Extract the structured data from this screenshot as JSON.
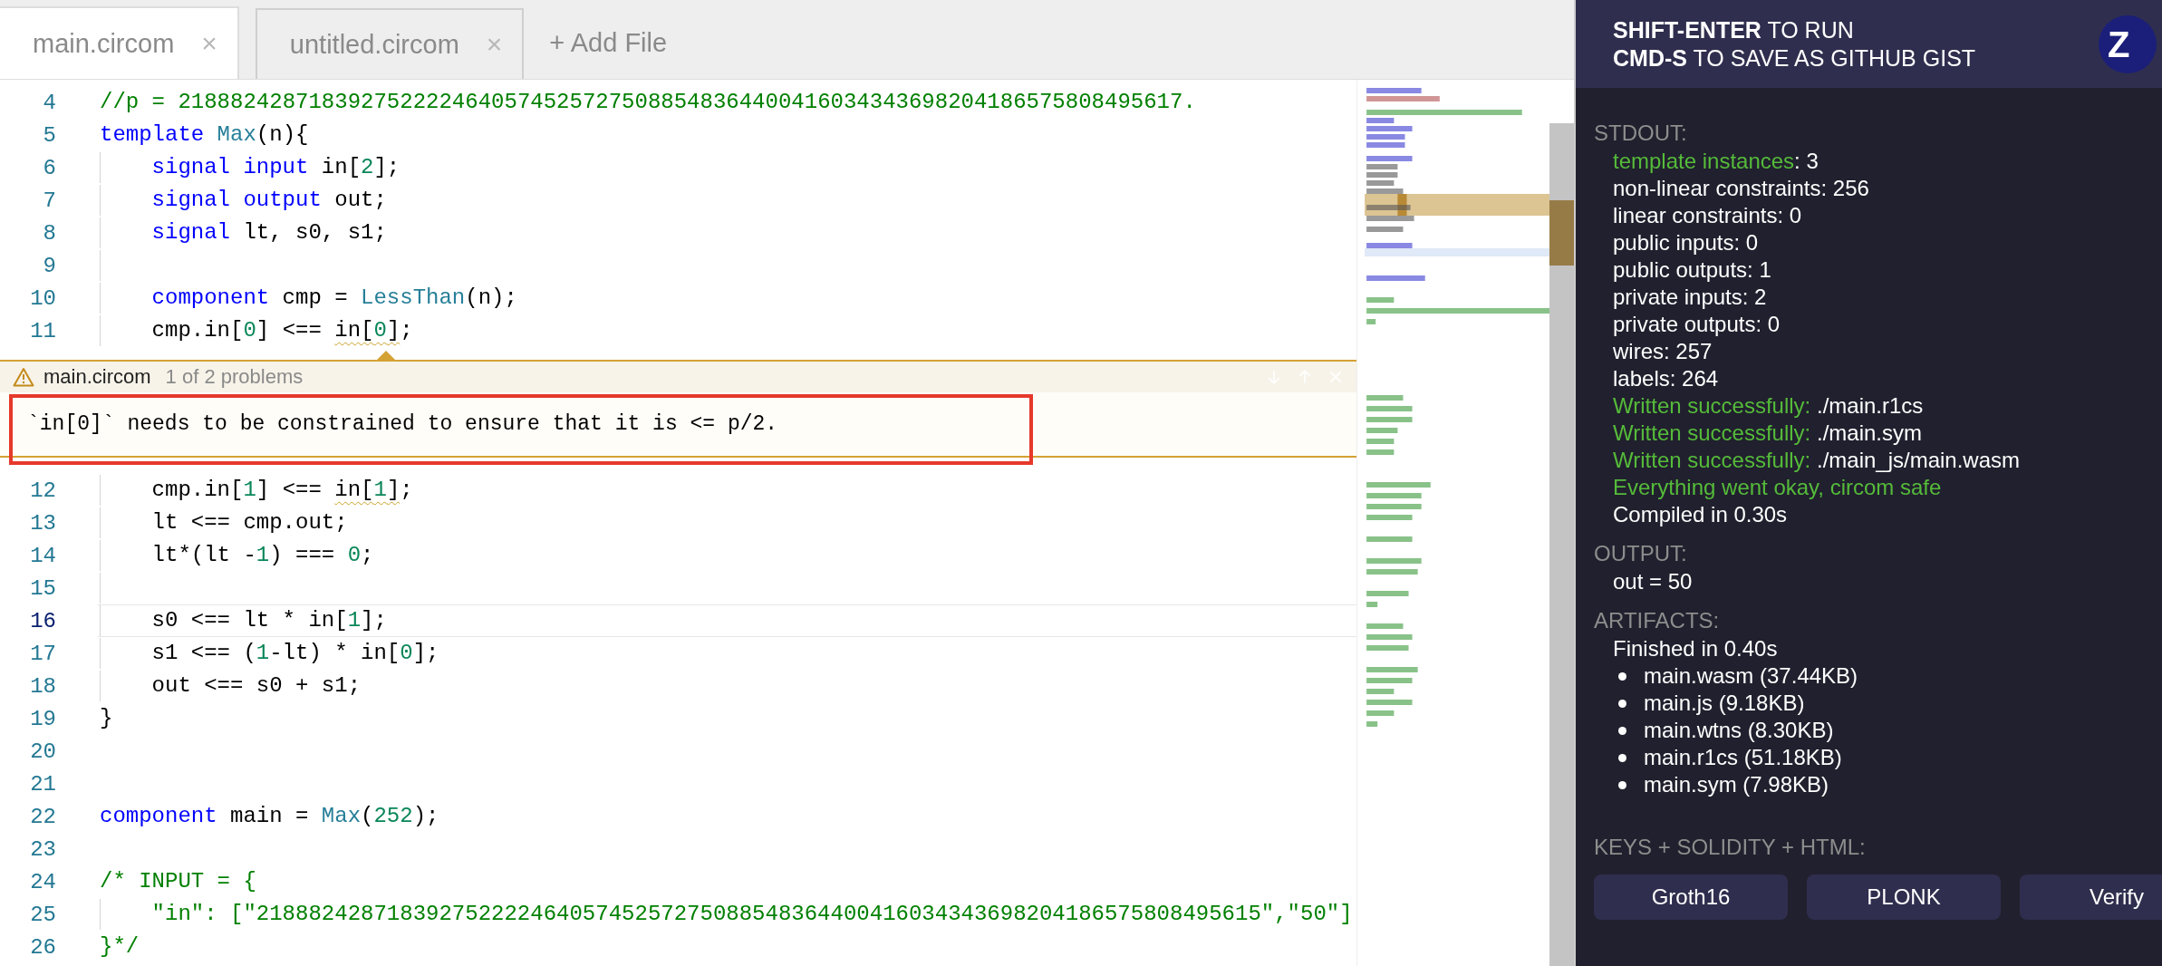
{
  "tabs": [
    {
      "label": "main.circom",
      "close": "×",
      "selected": true
    },
    {
      "label": "untitled.circom",
      "close": "×",
      "selected": false
    }
  ],
  "add_file": "+ Add File",
  "editor": {
    "lines": [
      {
        "kind": "code",
        "number": "4",
        "current": false,
        "indented": false,
        "tokens": [
          {
            "text": "//p = 21888242871839275222246405745257275088548364400416034343698204186575808495617.",
            "kind": "comment",
            "squiggly": false
          }
        ]
      },
      {
        "kind": "code",
        "number": "5",
        "current": false,
        "indented": false,
        "tokens": [
          {
            "text": "template",
            "kind": "keyword",
            "squiggly": false
          },
          {
            "text": " Max",
            "kind": "type",
            "squiggly": false
          },
          {
            "text": "(n){",
            "kind": "plain",
            "squiggly": false
          }
        ]
      },
      {
        "kind": "code",
        "number": "6",
        "current": false,
        "indented": true,
        "tokens": [
          {
            "text": "signal input",
            "kind": "keyword",
            "squiggly": false
          },
          {
            "text": " in[",
            "kind": "plain",
            "squiggly": false
          },
          {
            "text": "2",
            "kind": "number",
            "squiggly": false
          },
          {
            "text": "];",
            "kind": "plain",
            "squiggly": false
          }
        ]
      },
      {
        "kind": "code",
        "number": "7",
        "current": false,
        "indented": true,
        "tokens": [
          {
            "text": "signal output",
            "kind": "keyword",
            "squiggly": false
          },
          {
            "text": " out;",
            "kind": "plain",
            "squiggly": false
          }
        ]
      },
      {
        "kind": "code",
        "number": "8",
        "current": false,
        "indented": true,
        "tokens": [
          {
            "text": "signal",
            "kind": "keyword",
            "squiggly": false
          },
          {
            "text": " lt, s0, s1;",
            "kind": "plain",
            "squiggly": false
          }
        ]
      },
      {
        "kind": "code",
        "number": "9",
        "current": false,
        "indented": true
      },
      {
        "kind": "code",
        "number": "10",
        "current": false,
        "indented": true,
        "tokens": [
          {
            "text": "component",
            "kind": "keyword",
            "squiggly": false
          },
          {
            "text": " cmp = ",
            "kind": "plain",
            "squiggly": false
          },
          {
            "text": "LessThan",
            "kind": "type",
            "squiggly": false
          },
          {
            "text": "(n);",
            "kind": "plain",
            "squiggly": false
          }
        ]
      },
      {
        "kind": "code",
        "number": "11",
        "current": false,
        "indented": true,
        "tokens": [
          {
            "text": "cmp.in[",
            "kind": "plain",
            "squiggly": false
          },
          {
            "text": "0",
            "kind": "number",
            "squiggly": false
          },
          {
            "text": "] <== ",
            "kind": "plain",
            "squiggly": false
          },
          {
            "text": "in[",
            "kind": "plain",
            "squiggly": true
          },
          {
            "text": "0",
            "kind": "number",
            "squiggly": true
          },
          {
            "text": "]",
            "kind": "plain",
            "squiggly": true
          },
          {
            "text": ";",
            "kind": "plain",
            "squiggly": false
          }
        ]
      },
      {
        "kind": "problem",
        "file": "main.circom",
        "count": "1 of 2 problems",
        "message": "`in[0]` needs to be constrained to ensure that it is <= p/2."
      },
      {
        "kind": "code",
        "number": "12",
        "current": false,
        "indented": true,
        "tokens": [
          {
            "text": "cmp.in[",
            "kind": "plain",
            "squiggly": false
          },
          {
            "text": "1",
            "kind": "number",
            "squiggly": false
          },
          {
            "text": "] <== ",
            "kind": "plain",
            "squiggly": false
          },
          {
            "text": "in[",
            "kind": "plain",
            "squiggly": true
          },
          {
            "text": "1",
            "kind": "number",
            "squiggly": true
          },
          {
            "text": "]",
            "kind": "plain",
            "squiggly": true
          },
          {
            "text": ";",
            "kind": "plain",
            "squiggly": false
          }
        ]
      },
      {
        "kind": "code",
        "number": "13",
        "current": false,
        "indented": true,
        "tokens": [
          {
            "text": "lt <== cmp.out;",
            "kind": "plain",
            "squiggly": false
          }
        ]
      },
      {
        "kind": "code",
        "number": "14",
        "current": false,
        "indented": true,
        "tokens": [
          {
            "text": "lt*(lt -",
            "kind": "plain",
            "squiggly": false
          },
          {
            "text": "1",
            "kind": "number",
            "squiggly": false
          },
          {
            "text": ") === ",
            "kind": "plain",
            "squiggly": false
          },
          {
            "text": "0",
            "kind": "number",
            "squiggly": false
          },
          {
            "text": ";",
            "kind": "plain",
            "squiggly": false
          }
        ]
      },
      {
        "kind": "code",
        "number": "15",
        "current": false,
        "indented": true
      },
      {
        "kind": "code",
        "number": "16",
        "current": true,
        "indented": true,
        "tokens": [
          {
            "text": "s0 <== lt * in[",
            "kind": "plain",
            "squiggly": false
          },
          {
            "text": "1",
            "kind": "number",
            "squiggly": false
          },
          {
            "text": "];",
            "kind": "plain",
            "squiggly": false
          }
        ]
      },
      {
        "kind": "code",
        "number": "17",
        "current": false,
        "indented": true,
        "tokens": [
          {
            "text": "s1 <== (",
            "kind": "plain",
            "squiggly": false
          },
          {
            "text": "1",
            "kind": "number",
            "squiggly": false
          },
          {
            "text": "-lt) * in[",
            "kind": "plain",
            "squiggly": false
          },
          {
            "text": "0",
            "kind": "number",
            "squiggly": false
          },
          {
            "text": "];",
            "kind": "plain",
            "squiggly": false
          }
        ]
      },
      {
        "kind": "code",
        "number": "18",
        "current": false,
        "indented": true,
        "tokens": [
          {
            "text": "out <== s0 + s1;",
            "kind": "plain",
            "squiggly": false
          }
        ]
      },
      {
        "kind": "code",
        "number": "19",
        "current": false,
        "indented": false,
        "tokens": [
          {
            "text": "}",
            "kind": "plain",
            "squiggly": false
          }
        ]
      },
      {
        "kind": "code",
        "number": "20",
        "current": false,
        "indented": false
      },
      {
        "kind": "code",
        "number": "21",
        "current": false,
        "indented": false
      },
      {
        "kind": "code",
        "number": "22",
        "current": false,
        "indented": false,
        "tokens": [
          {
            "text": "component",
            "kind": "keyword",
            "squiggly": false
          },
          {
            "text": " main = ",
            "kind": "plain",
            "squiggly": false
          },
          {
            "text": "Max",
            "kind": "type",
            "squiggly": false
          },
          {
            "text": "(",
            "kind": "plain",
            "squiggly": false
          },
          {
            "text": "252",
            "kind": "number",
            "squiggly": false
          },
          {
            "text": ");",
            "kind": "plain",
            "squiggly": false
          }
        ]
      },
      {
        "kind": "code",
        "number": "23",
        "current": false,
        "indented": false
      },
      {
        "kind": "code",
        "number": "24",
        "current": false,
        "indented": false,
        "tokens": [
          {
            "text": "/* INPUT = {",
            "kind": "comment",
            "squiggly": false
          }
        ]
      },
      {
        "kind": "code",
        "number": "25",
        "current": false,
        "indented": true,
        "tokens": [
          {
            "text": "\"in\": [\"21888242871839275222246405745257275088548364400416034343698204186575808495615\",\"50\"]",
            "kind": "comment",
            "squiggly": false
          }
        ]
      },
      {
        "kind": "code",
        "number": "26",
        "current": false,
        "indented": false,
        "tokens": [
          {
            "text": "}*/",
            "kind": "comment",
            "squiggly": false
          }
        ]
      }
    ]
  },
  "panel": {
    "header": [
      [
        {
          "text": "SHIFT-ENTER",
          "bold": true
        },
        {
          "text": " TO RUN",
          "bold": false
        }
      ],
      [
        {
          "text": "CMD-S",
          "bold": true
        },
        {
          "text": " TO SAVE AS GITHUB GIST",
          "bold": false
        }
      ]
    ],
    "logo": "Z",
    "sections": [
      {
        "kind": "log",
        "title": "STDOUT:",
        "lines": [
          [
            {
              "text": "template instances",
              "kind": "ok"
            },
            {
              "text": ": 3",
              "kind": "plain"
            }
          ],
          [
            {
              "text": "non-linear constraints: 256",
              "kind": "plain"
            }
          ],
          [
            {
              "text": "linear constraints: 0",
              "kind": "plain"
            }
          ],
          [
            {
              "text": "public inputs: 0",
              "kind": "plain"
            }
          ],
          [
            {
              "text": "public outputs: 1",
              "kind": "plain"
            }
          ],
          [
            {
              "text": "private inputs: 2",
              "kind": "plain"
            }
          ],
          [
            {
              "text": "private outputs: 0",
              "kind": "plain"
            }
          ],
          [
            {
              "text": "wires: 257",
              "kind": "plain"
            }
          ],
          [
            {
              "text": "labels: 264",
              "kind": "plain"
            }
          ],
          [
            {
              "text": "Written successfully:",
              "kind": "ok"
            },
            {
              "text": " ./main.r1cs",
              "kind": "plain"
            }
          ],
          [
            {
              "text": "Written successfully:",
              "kind": "ok"
            },
            {
              "text": " ./main.sym",
              "kind": "plain"
            }
          ],
          [
            {
              "text": "Written successfully:",
              "kind": "ok"
            },
            {
              "text": " ./main_js/main.wasm",
              "kind": "plain"
            }
          ],
          [
            {
              "text": "Everything went okay, circom safe",
              "kind": "ok"
            }
          ],
          [
            {
              "text": "Compiled in 0.30s",
              "kind": "plain"
            }
          ]
        ]
      },
      {
        "kind": "log",
        "title": "OUTPUT:",
        "lines": [
          [
            {
              "text": "out = 50",
              "kind": "plain"
            }
          ]
        ]
      },
      {
        "kind": "list",
        "title": "ARTIFACTS:",
        "summary": "Finished in 0.40s",
        "items": [
          "main.wasm (37.44KB)",
          "main.js (9.18KB)",
          "main.wtns (8.30KB)",
          "main.r1cs (51.18KB)",
          "main.sym (7.98KB)"
        ]
      },
      {
        "kind": "buttons",
        "title": "KEYS + SOLIDITY + HTML:",
        "buttons": [
          "Groth16",
          "PLONK",
          "Verify"
        ]
      }
    ]
  }
}
